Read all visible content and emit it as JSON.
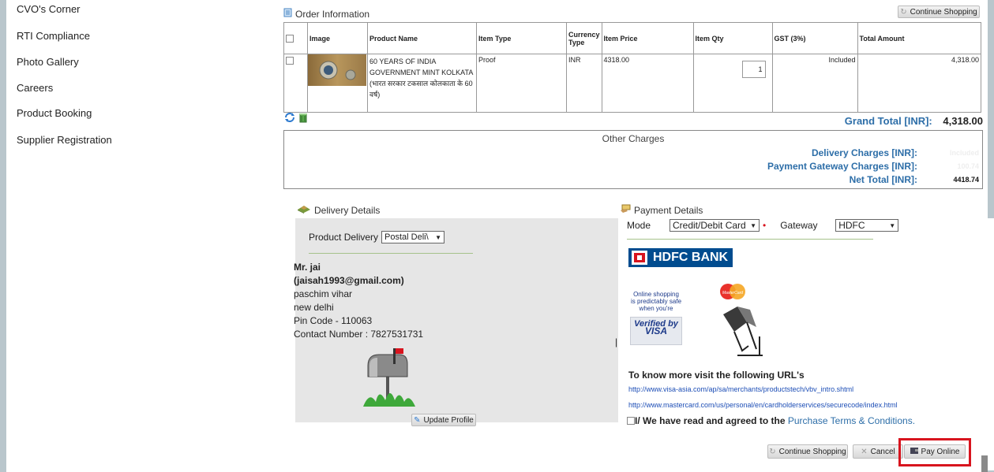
{
  "sidebar": {
    "items": [
      {
        "label": "CVO's Corner"
      },
      {
        "label": "RTI Compliance"
      },
      {
        "label": "Photo Gallery"
      },
      {
        "label": "Careers"
      },
      {
        "label": "Product Booking"
      },
      {
        "label": "Supplier Registration"
      }
    ]
  },
  "order": {
    "title": "Order Information",
    "continue_label": "Continue Shopping",
    "headers": {
      "image": "Image",
      "product": "Product Name",
      "item_type": "Item Type",
      "currency": "Currency Type",
      "price": "Item Price",
      "qty": "Item Qty",
      "gst": "GST (3%)",
      "total": "Total Amount"
    },
    "row": {
      "product_en": "60 YEARS OF INDIA GOVERNMENT MINT KOLKATA",
      "product_hi": "(भारत सरकार टकसाल कोलकाता के 60 वर्ष)",
      "item_type": "Proof",
      "currency": "INR",
      "price": "4318.00",
      "qty": "1",
      "gst": "Included",
      "total": "4,318.00"
    },
    "grand_total_label": "Grand Total [INR]:",
    "grand_total_value": "4,318.00"
  },
  "charges": {
    "title": "Other Charges",
    "delivery_label": "Delivery Charges [INR]:",
    "delivery_value": "Included",
    "gateway_label": "Payment Gateway Charges [INR]:",
    "gateway_value": "100.74",
    "net_label": "Net Total [INR]:",
    "net_value": "4418.74"
  },
  "delivery": {
    "title": "Delivery Details",
    "product_delivery_label": "Product Delivery",
    "product_delivery_value": "Postal Deli\\",
    "name": "Mr. jai",
    "email": "(jaisah1993@gmail.com)",
    "address1": "paschim vihar",
    "address2": "new delhi",
    "pincode": "Pin Code - 110063",
    "contact": "Contact Number :  7827531731",
    "update_label": "Update Profile"
  },
  "payment": {
    "title": "Payment Details",
    "mode_label": "Mode",
    "mode_value": "Credit/Debit Card",
    "gateway_label": "Gateway",
    "gateway_value": "HDFC",
    "bank_name": "HDFC BANK",
    "visa_text1": "Online shopping",
    "visa_text2": "is predictably safe",
    "visa_text3": "when you're",
    "visa_verified": "Verified by",
    "visa_brand": "VISA",
    "mc_brand": "MasterCard",
    "know_more": "To know more visit the following URL's",
    "url_visa": "http://www.visa-asia.com/ap/sa/merchants/productstech/vbv_intro.shtml",
    "url_mc": "http://www.mastercard.com/us/personal/en/cardholderservices/securecode/index.html",
    "agree_text": "I/ We have read and agreed to the ",
    "terms_link": "Purchase Terms & Conditions.",
    "continue_label": "Continue Shopping",
    "cancel_label": "Cancel",
    "pay_label": "Pay Online"
  },
  "colors": {
    "accent_blue": "#2d6ea8",
    "highlight_red": "#d8141e",
    "hdfc_blue": "#004c8f"
  }
}
